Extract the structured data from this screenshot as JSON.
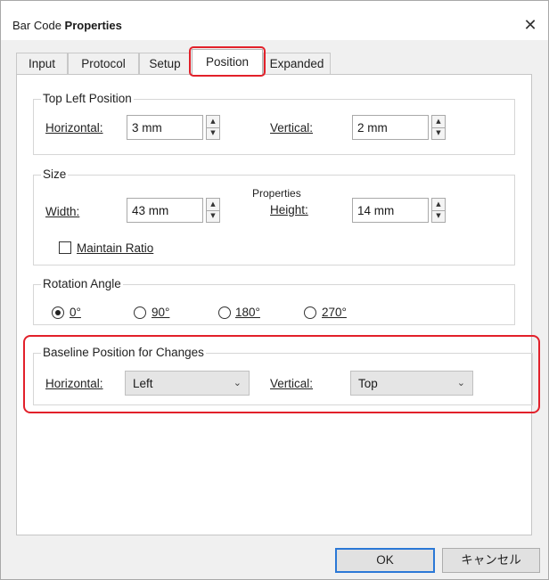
{
  "window": {
    "title_prefix": "Bar Code",
    "title_bold": "Properties",
    "close_glyph": "✕"
  },
  "tabs": [
    {
      "label": "Input",
      "active": false
    },
    {
      "label": "Protocol",
      "active": false
    },
    {
      "label": "Setup",
      "active": false
    },
    {
      "label": "Position",
      "active": true
    },
    {
      "label": "Expanded",
      "active": false
    }
  ],
  "top_left_position": {
    "legend": "Top Left Position",
    "horizontal_label": "Horizontal:",
    "horizontal_value": "3 mm",
    "vertical_label": "Vertical:",
    "vertical_value": "2 mm"
  },
  "size": {
    "legend": "Size",
    "width_label": "Width:",
    "width_value": "43 mm",
    "properties_label": "Properties",
    "height_label": "Height:",
    "height_value": "14 mm",
    "maintain_ratio_label": "Maintain Ratio",
    "maintain_ratio_checked": false
  },
  "rotation_angle": {
    "legend": "Rotation Angle",
    "options": [
      "0°",
      "90°",
      "180°",
      "270°"
    ],
    "selected": "0°"
  },
  "baseline_position": {
    "legend": "Baseline Position for Changes",
    "horizontal_label": "Horizontal:",
    "horizontal_value": "Left",
    "vertical_label": "Vertical:",
    "vertical_value": "Top"
  },
  "buttons": {
    "ok": "OK",
    "cancel": "キャンセル"
  },
  "spinner_glyphs": {
    "up": "▲",
    "down": "▼"
  },
  "chevron_glyph": "⌄",
  "colors": {
    "highlight": "#e2202a",
    "default_button_border": "#2b78d6"
  }
}
